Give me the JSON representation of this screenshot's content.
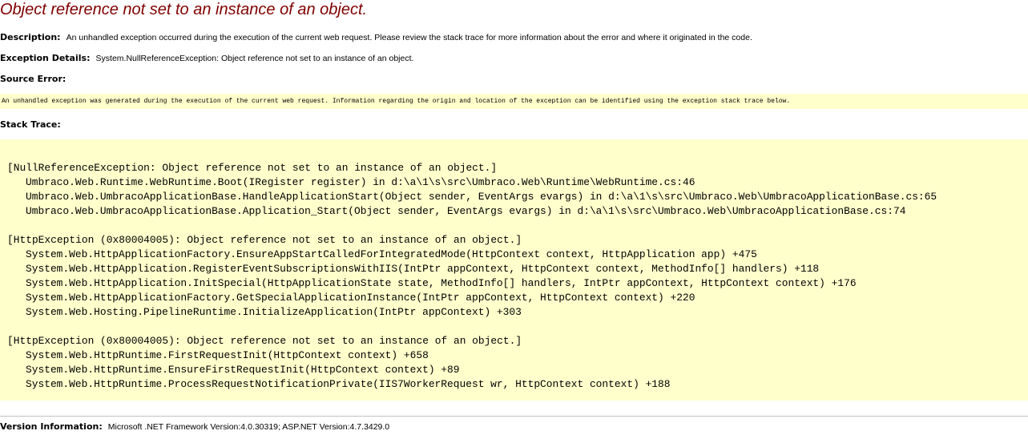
{
  "page": {
    "title": "Object reference not set to an instance of an object."
  },
  "description": {
    "label": "Description:",
    "text": "An unhandled exception occurred during the execution of the current web request. Please review the stack trace for more information about the error and where it originated in the code."
  },
  "exception_details": {
    "label": "Exception Details:",
    "text": "System.NullReferenceException: Object reference not set to an instance of an object."
  },
  "source_error": {
    "label": "Source Error:",
    "text": "An unhandled exception was generated during the execution of the current web request. Information regarding the origin and location of the exception can be identified using the exception stack trace below."
  },
  "stack_trace": {
    "label": "Stack Trace:",
    "blocks": [
      {
        "header": "[NullReferenceException: Object reference not set to an instance of an object.]",
        "frames": [
          "Umbraco.Web.Runtime.WebRuntime.Boot(IRegister register) in d:\\a\\1\\s\\src\\Umbraco.Web\\Runtime\\WebRuntime.cs:46",
          "Umbraco.Web.UmbracoApplicationBase.HandleApplicationStart(Object sender, EventArgs evargs) in d:\\a\\1\\s\\src\\Umbraco.Web\\UmbracoApplicationBase.cs:65",
          "Umbraco.Web.UmbracoApplicationBase.Application_Start(Object sender, EventArgs evargs) in d:\\a\\1\\s\\src\\Umbraco.Web\\UmbracoApplicationBase.cs:74"
        ]
      },
      {
        "header": "[HttpException (0x80004005): Object reference not set to an instance of an object.]",
        "frames": [
          "System.Web.HttpApplicationFactory.EnsureAppStartCalledForIntegratedMode(HttpContext context, HttpApplication app) +475",
          "System.Web.HttpApplication.RegisterEventSubscriptionsWithIIS(IntPtr appContext, HttpContext context, MethodInfo[] handlers) +118",
          "System.Web.HttpApplication.InitSpecial(HttpApplicationState state, MethodInfo[] handlers, IntPtr appContext, HttpContext context) +176",
          "System.Web.HttpApplicationFactory.GetSpecialApplicationInstance(IntPtr appContext, HttpContext context) +220",
          "System.Web.Hosting.PipelineRuntime.InitializeApplication(IntPtr appContext) +303"
        ]
      },
      {
        "header": "[HttpException (0x80004005): Object reference not set to an instance of an object.]",
        "frames": [
          "System.Web.HttpRuntime.FirstRequestInit(HttpContext context) +658",
          "System.Web.HttpRuntime.EnsureFirstRequestInit(HttpContext context) +89",
          "System.Web.HttpRuntime.ProcessRequestNotificationPrivate(IIS7WorkerRequest wr, HttpContext context) +188"
        ]
      }
    ]
  },
  "version_info": {
    "label": "Version Information:",
    "text": "Microsoft .NET Framework Version:4.0.30319; ASP.NET Version:4.7.3429.0"
  },
  "colors": {
    "title": "#800000",
    "code_background": "#ffffcc",
    "divider": "#c0c0c0"
  }
}
